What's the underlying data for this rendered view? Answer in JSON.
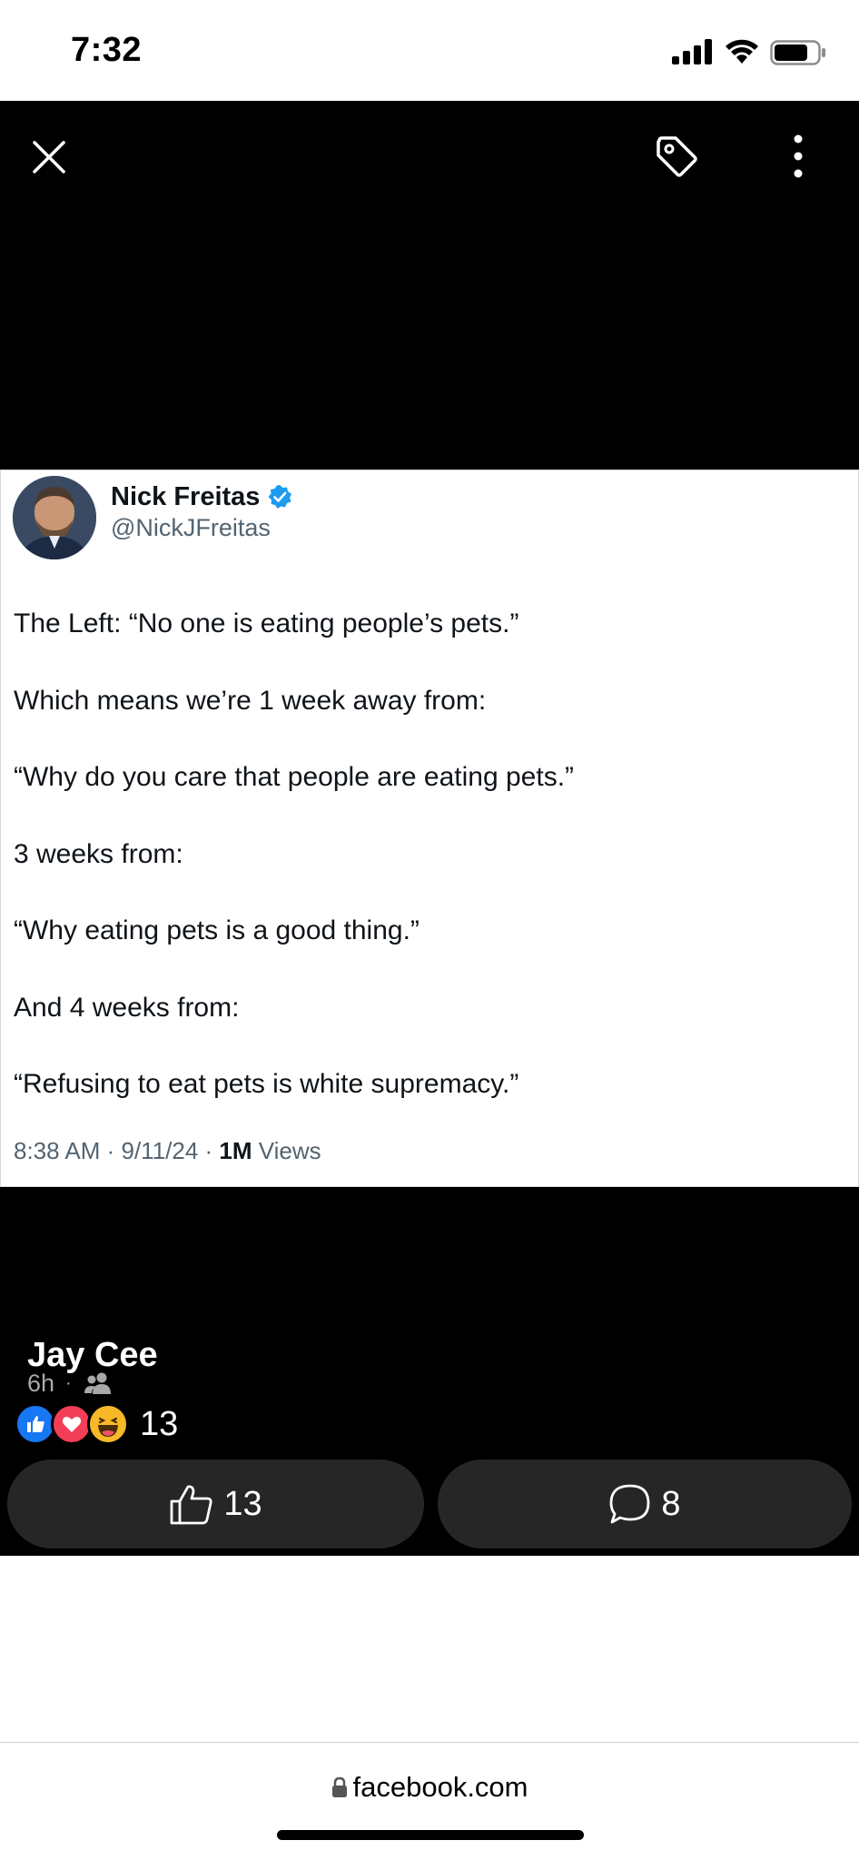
{
  "status_bar": {
    "time": "7:32"
  },
  "tweet": {
    "name": "Nick Freitas",
    "handle": "@NickJFreitas",
    "lines": [
      "The Left: “No one is eating people’s pets.”",
      "Which means we’re  1 week away from:",
      "“Why do you care that people are eating pets.”",
      "3 weeks from:",
      "“Why eating pets is a good thing.”",
      "And 4 weeks from:",
      "“Refusing to eat pets is white supremacy.”"
    ],
    "meta_prefix": "8:38 AM · 9/11/24 · ",
    "views_count": "1M",
    "views_label": " Views"
  },
  "post": {
    "poster_name": "Jay Cee",
    "age": "6h",
    "separator": "·",
    "reaction_count": "13",
    "like_count": "13",
    "comment_count": "8"
  },
  "browser": {
    "url": "facebook.com"
  },
  "colors": {
    "background": "#000000",
    "button": "#262626",
    "like_blue": "#1877f2",
    "love_red": "#f33e58",
    "haha_yellow": "#f7b928",
    "verified": "#1d9bf0"
  },
  "icons": [
    "signal-icon",
    "wifi-icon",
    "battery-icon",
    "close-icon",
    "tag-icon",
    "more-icon",
    "verified-icon",
    "friends-icon",
    "like-reaction-icon",
    "love-reaction-icon",
    "haha-reaction-icon",
    "thumbs-up-icon",
    "comment-icon",
    "lock-icon"
  ]
}
